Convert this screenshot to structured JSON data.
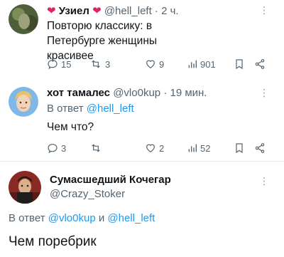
{
  "tweets": [
    {
      "author_name": "Узиел",
      "handle": "@hell_left",
      "time": "2 ч.",
      "text": "Повторю классику: в Петербурге женщины красивее",
      "stats": {
        "replies": "15",
        "retweets": "3",
        "likes": "9",
        "views": "901"
      },
      "more": "⋮"
    },
    {
      "author_name": "хот тамалес",
      "handle": "@vlo0kup",
      "time": "19 мин.",
      "reply_prefix": "В ответ",
      "reply_to": "@hell_left",
      "text": "Чем что?",
      "stats": {
        "replies": "3",
        "retweets": "",
        "likes": "2",
        "views": "52"
      },
      "more": "⋮"
    },
    {
      "author_name": "Сумасшедший Кочегар",
      "handle": "@Crazy_Stoker",
      "reply_prefix": "В ответ",
      "reply_to_1": "@vlo0kup",
      "reply_and": "и",
      "reply_to_2": "@hell_left",
      "text": "Чем поребрик",
      "more": "⋮"
    }
  ],
  "colors": {
    "accent": "#1d9bf0",
    "muted": "#536471",
    "heart": "#e0245e"
  },
  "icons": [
    "heart-emoji-icon",
    "reply-icon",
    "retweet-icon",
    "like-icon",
    "views-icon",
    "bookmark-icon",
    "share-icon",
    "more-icon"
  ]
}
